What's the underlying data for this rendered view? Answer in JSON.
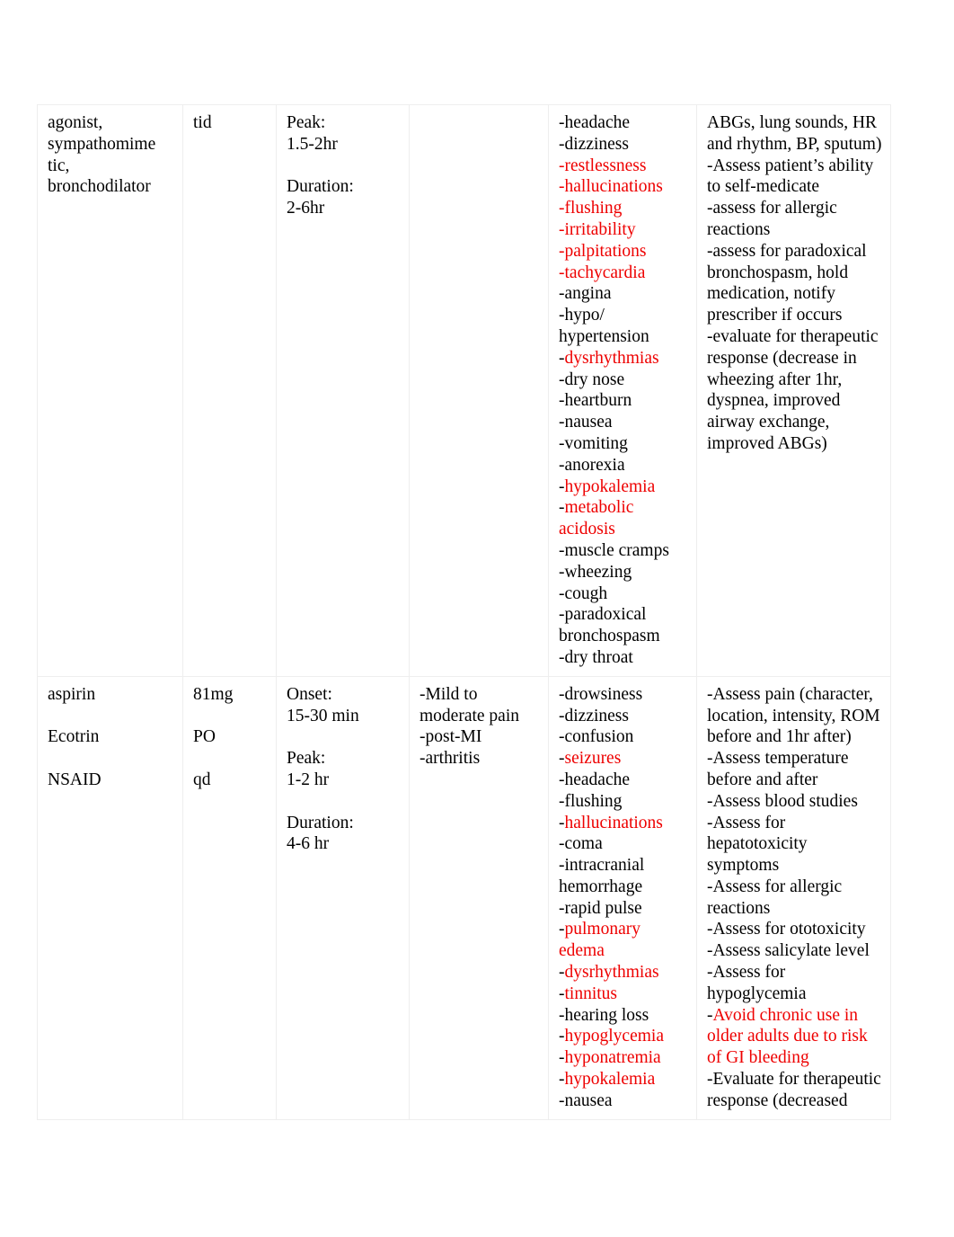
{
  "document": {
    "type": "drug-card-table",
    "page_background": "#ffffff",
    "accent_red": "#ee0000",
    "border_color": "#eeeeee"
  },
  "table": {
    "columns": [
      {
        "key": "drug",
        "name": "drug-class-column"
      },
      {
        "key": "dose",
        "name": "dose-route-frequency-column"
      },
      {
        "key": "onset",
        "name": "onset-peak-duration-column"
      },
      {
        "key": "indic",
        "name": "indications-column"
      },
      {
        "key": "adverse",
        "name": "adverse-effects-column"
      },
      {
        "key": "nursing",
        "name": "nursing-considerations-column"
      }
    ],
    "rows": [
      {
        "name": "row-albuterol-continuation",
        "drug": [
          {
            "text": "agonist,"
          },
          {
            "text": "sympathomime"
          },
          {
            "text": "tic,"
          },
          {
            "text": "bronchodilator"
          }
        ],
        "dose": [
          {
            "text": "tid"
          }
        ],
        "onset": [
          {
            "text": "Peak:"
          },
          {
            "text": "1.5-2hr"
          },
          {
            "text": ""
          },
          {
            "text": "Duration:"
          },
          {
            "text": "2-6hr"
          }
        ],
        "indic": [],
        "adverse": [
          {
            "dash": "-",
            "text": "headache",
            "color": "black"
          },
          {
            "dash": "-",
            "text": "dizziness",
            "color": "black"
          },
          {
            "dash": "-",
            "text": "restlessness",
            "color": "red",
            "dash_color": "red"
          },
          {
            "dash": "-",
            "text": "hallucinations",
            "color": "red",
            "dash_color": "red"
          },
          {
            "dash": "-",
            "text": "flushing",
            "color": "red",
            "dash_color": "red"
          },
          {
            "dash": "-",
            "text": "irritability",
            "color": "red",
            "dash_color": "red"
          },
          {
            "dash": "-",
            "text": "palpitations",
            "color": "red",
            "dash_color": "red"
          },
          {
            "dash": "-",
            "text": "tachycardia",
            "color": "red",
            "dash_color": "red"
          },
          {
            "dash": "-",
            "text": "angina",
            "color": "black"
          },
          {
            "dash": "-",
            "text": "hypo/ hypertension",
            "color": "black"
          },
          {
            "dash": "-",
            "text": "dysrhythmias",
            "color": "red",
            "dash_color": "black"
          },
          {
            "dash": "-",
            "text": "dry nose",
            "color": "black"
          },
          {
            "dash": "-",
            "text": "heartburn",
            "color": "black"
          },
          {
            "dash": "-",
            "text": "nausea",
            "color": "black"
          },
          {
            "dash": "-",
            "text": "vomiting",
            "color": "black"
          },
          {
            "dash": "-",
            "text": "anorexia",
            "color": "black"
          },
          {
            "dash": "-",
            "text": "hypokalemia",
            "color": "red",
            "dash_color": "black"
          },
          {
            "dash": "-",
            "text": "metabolic acidosis",
            "color": "red",
            "dash_color": "black"
          },
          {
            "dash": "-",
            "text": "muscle cramps",
            "color": "black"
          },
          {
            "dash": "-",
            "text": "wheezing",
            "color": "black"
          },
          {
            "dash": "-",
            "text": "cough",
            "color": "black"
          },
          {
            "dash": "-",
            "text": "paradoxical bronchospasm",
            "color": "black"
          },
          {
            "dash": "-",
            "text": "dry throat",
            "color": "black"
          }
        ],
        "nursing": [
          {
            "dash": "",
            "text": "ABGs, lung sounds, HR and rhythm, BP, sputum)",
            "color": "black"
          },
          {
            "dash": "-",
            "text": "Assess patient’s ability to self-medicate",
            "color": "black"
          },
          {
            "dash": "-",
            "text": "assess for allergic reactions",
            "color": "black"
          },
          {
            "dash": "-",
            "text": "assess for paradoxical bronchospasm, hold medication, notify prescriber if occurs",
            "color": "black"
          },
          {
            "dash": "-",
            "text": "evaluate for therapeutic response (decrease in wheezing after 1hr, dyspnea, improved airway exchange, improved ABGs)",
            "color": "black"
          }
        ]
      },
      {
        "name": "row-aspirin",
        "drug": [
          {
            "text": "aspirin"
          },
          {
            "text": ""
          },
          {
            "text": "Ecotrin"
          },
          {
            "text": ""
          },
          {
            "text": "NSAID"
          }
        ],
        "dose": [
          {
            "text": "81mg"
          },
          {
            "text": ""
          },
          {
            "text": "PO"
          },
          {
            "text": ""
          },
          {
            "text": "qd"
          }
        ],
        "onset": [
          {
            "text": "Onset:"
          },
          {
            "text": "15-30 min"
          },
          {
            "text": ""
          },
          {
            "text": "Peak:"
          },
          {
            "text": "1-2 hr"
          },
          {
            "text": ""
          },
          {
            "text": "Duration:"
          },
          {
            "text": "4-6 hr"
          }
        ],
        "indic": [
          {
            "dash": "-",
            "text": "Mild to moderate pain",
            "color": "black"
          },
          {
            "dash": "-",
            "text": "post-MI",
            "color": "black"
          },
          {
            "dash": "-",
            "text": "arthritis",
            "color": "black"
          }
        ],
        "adverse": [
          {
            "dash": "-",
            "text": "drowsiness",
            "color": "black"
          },
          {
            "dash": "-",
            "text": "dizziness",
            "color": "black"
          },
          {
            "dash": "-",
            "text": "confusion",
            "color": "black"
          },
          {
            "dash": "-",
            "text": "seizures",
            "color": "red",
            "dash_color": "black"
          },
          {
            "dash": "-",
            "text": "headache",
            "color": "black"
          },
          {
            "dash": "-",
            "text": "flushing",
            "color": "black"
          },
          {
            "dash": "-",
            "text": "hallucinations",
            "color": "red",
            "dash_color": "black"
          },
          {
            "dash": "-",
            "text": "coma",
            "color": "black"
          },
          {
            "dash": "-",
            "text": "intracranial hemorrhage",
            "color": "black"
          },
          {
            "dash": "-",
            "text": "rapid pulse",
            "color": "black"
          },
          {
            "dash": "-",
            "text": "pulmonary edema",
            "color": "red",
            "dash_color": "black"
          },
          {
            "dash": "-",
            "text": "dysrhythmias",
            "color": "red",
            "dash_color": "black"
          },
          {
            "dash": "-",
            "text": "tinnitus",
            "color": "red",
            "dash_color": "black"
          },
          {
            "dash": "-",
            "text": "hearing loss",
            "color": "black"
          },
          {
            "dash": "-",
            "text": "hypoglycemia",
            "color": "red",
            "dash_color": "black"
          },
          {
            "dash": "-",
            "text": "hyponatremia",
            "color": "red",
            "dash_color": "black"
          },
          {
            "dash": "-",
            "text": "hypokalemia",
            "color": "red",
            "dash_color": "black"
          },
          {
            "dash": "-",
            "text": "nausea",
            "color": "black"
          }
        ],
        "nursing": [
          {
            "dash": "-",
            "text": "Assess pain (character, location, intensity, ROM before and 1hr after)",
            "color": "black"
          },
          {
            "dash": "-",
            "text": "Assess temperature before and after",
            "color": "black"
          },
          {
            "dash": "-",
            "text": "Assess blood studies",
            "color": "black"
          },
          {
            "dash": "-",
            "text": "Assess for hepatotoxicity symptoms",
            "color": "black"
          },
          {
            "dash": "-",
            "text": "Assess for allergic reactions",
            "color": "black"
          },
          {
            "dash": "-",
            "text": "Assess for ototoxicity",
            "color": "black"
          },
          {
            "dash": "-",
            "text": "Assess salicylate level",
            "color": "black"
          },
          {
            "dash": "-",
            "text": "Assess for hypoglycemia",
            "color": "black"
          },
          {
            "dash": "-",
            "text": "Avoid chronic use in older adults due to risk of GI bleeding",
            "color": "red",
            "dash_color": "black"
          },
          {
            "dash": "-",
            "text": "Evaluate for therapeutic response (decreased",
            "color": "black"
          }
        ]
      }
    ]
  }
}
